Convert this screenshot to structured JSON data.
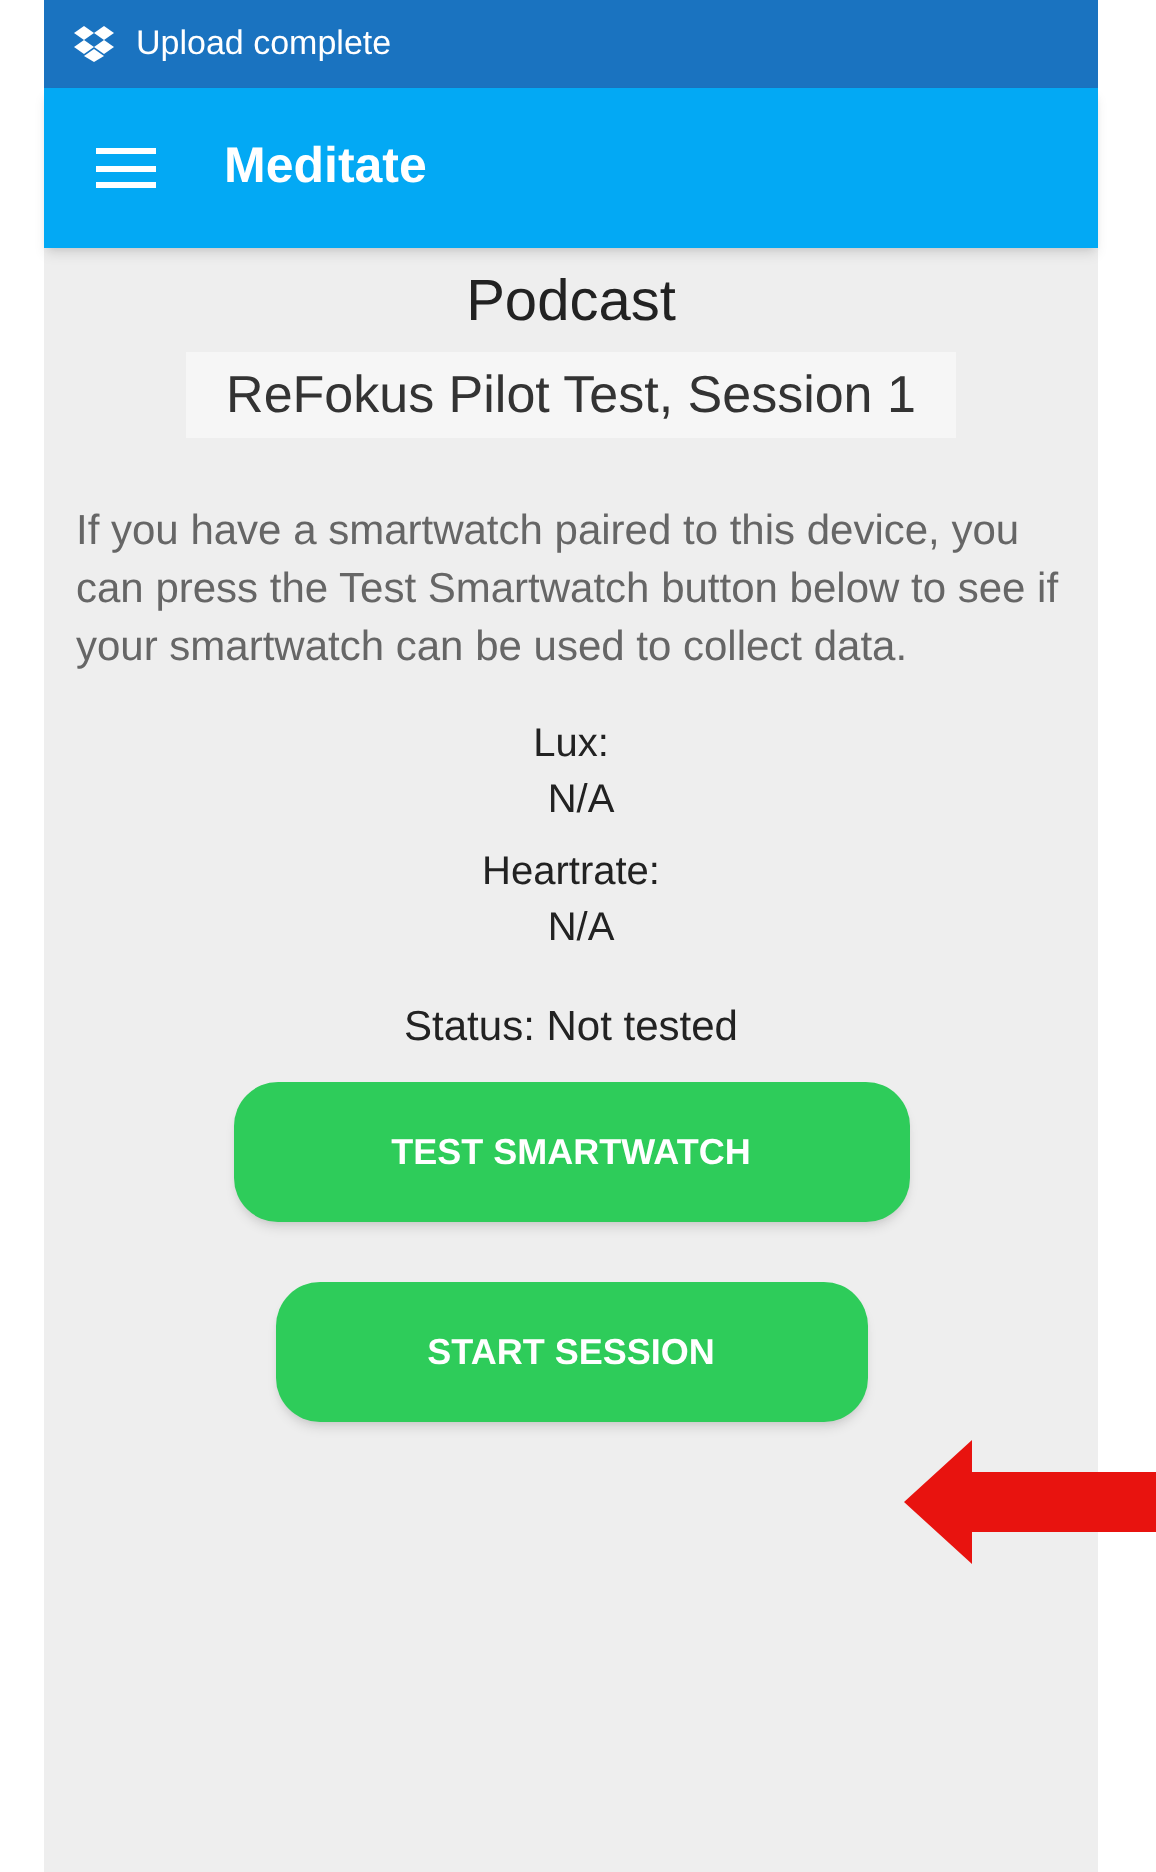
{
  "status_bar": {
    "notification": "Upload complete"
  },
  "app_bar": {
    "title": "Meditate"
  },
  "heading": "Podcast",
  "subtitle": "ReFokus Pilot Test, Session 1",
  "description": "If you have a smartwatch paired to this device, you can press the Test Smartwatch button below to see if your smartwatch can be used to collect data.",
  "readings": [
    {
      "label": "Lux:",
      "value": "N/A"
    },
    {
      "label": "Heartrate:",
      "value": "N/A"
    }
  ],
  "status": "Status: Not tested",
  "buttons": [
    "TEST SMARTWATCH",
    "START SESSION"
  ],
  "annotation": {
    "kind": "arrow"
  }
}
